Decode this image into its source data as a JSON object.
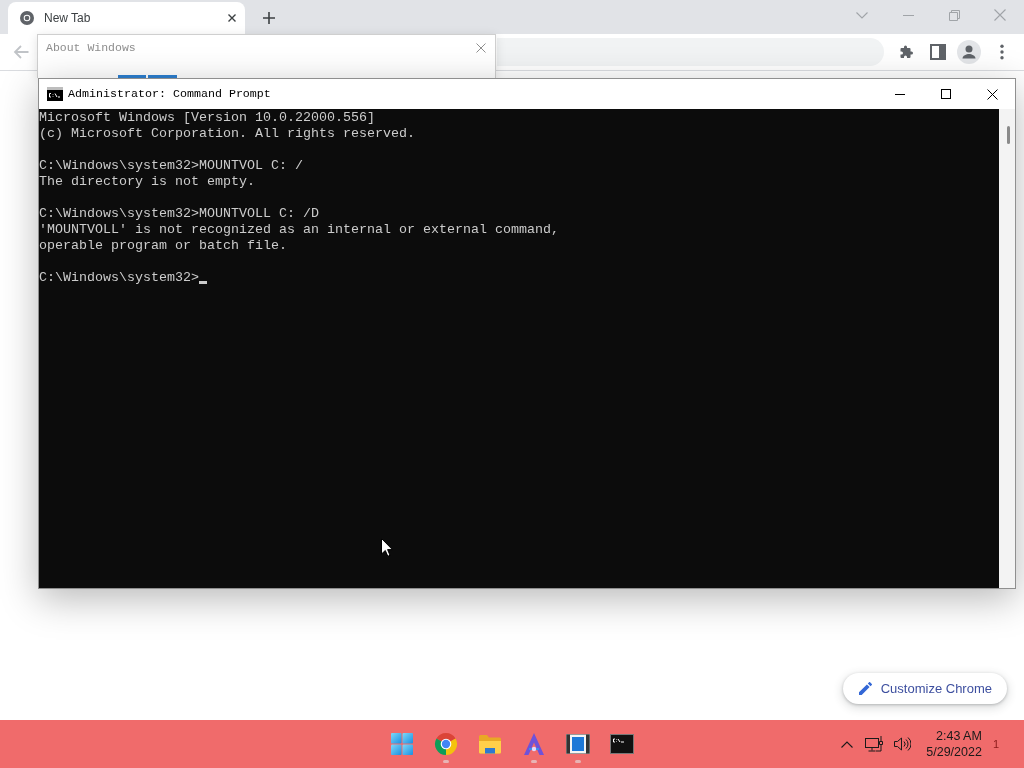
{
  "browser": {
    "tabs": [
      {
        "title": "New Tab",
        "selected": true
      }
    ],
    "back_button": {
      "disabled": true
    },
    "customize_button": {
      "label": "Customize Chrome"
    }
  },
  "about_dialog": {
    "title": "About Windows"
  },
  "console_window": {
    "title": "Administrator: Command Prompt",
    "blocks": [
      [
        "Microsoft Windows [Version 10.0.22000.556]",
        "(c) Microsoft Corporation. All rights reserved."
      ],
      [
        "C:\\Windows\\system32>MOUNTVOL C: /",
        "The directory is not empty."
      ],
      [
        "C:\\Windows\\system32>MOUNTVOLL C: /D",
        "'MOUNTVOLL' is not recognized as an internal or external command,",
        "operable program or batch file."
      ]
    ],
    "prompt": "C:\\Windows\\system32>"
  },
  "taskbar": {
    "apps": [
      {
        "kind": "start",
        "running": false
      },
      {
        "kind": "browser",
        "running": true
      },
      {
        "kind": "folder",
        "running": false
      },
      {
        "kind": "vector",
        "running": true
      },
      {
        "kind": "media",
        "running": true
      },
      {
        "kind": "terminal",
        "running": false
      }
    ],
    "tray": {
      "time": "2:43 AM",
      "date": "5/29/2022",
      "notification_count": "1"
    }
  }
}
